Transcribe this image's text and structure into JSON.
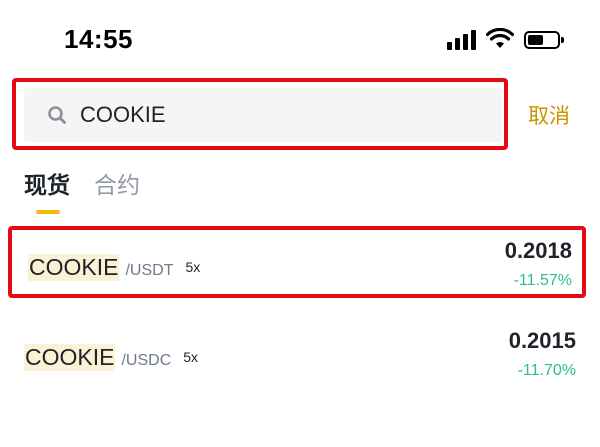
{
  "status_bar": {
    "time": "14:55",
    "battery_level": 0.55
  },
  "search": {
    "value": "COOKIE",
    "cancel_label": "取消"
  },
  "tabs": [
    {
      "label": "现货",
      "active": true
    },
    {
      "label": "合约",
      "active": false
    }
  ],
  "results": [
    {
      "base": "COOKIE",
      "quote": "/USDT",
      "leverage": "5x",
      "price": "0.2018",
      "change": "-11.57%"
    },
    {
      "base": "COOKIE",
      "quote": "/USDC",
      "leverage": "5x",
      "price": "0.2015",
      "change": "-11.70%"
    }
  ],
  "colors": {
    "accent": "#f0b90b",
    "cancel": "#c99400",
    "change_positive_display": "#2ebd85",
    "highlight_box": "#e50914"
  },
  "icons": {
    "search": "search-icon",
    "signal": "signal-icon",
    "wifi": "wifi-icon",
    "battery": "battery-icon"
  }
}
